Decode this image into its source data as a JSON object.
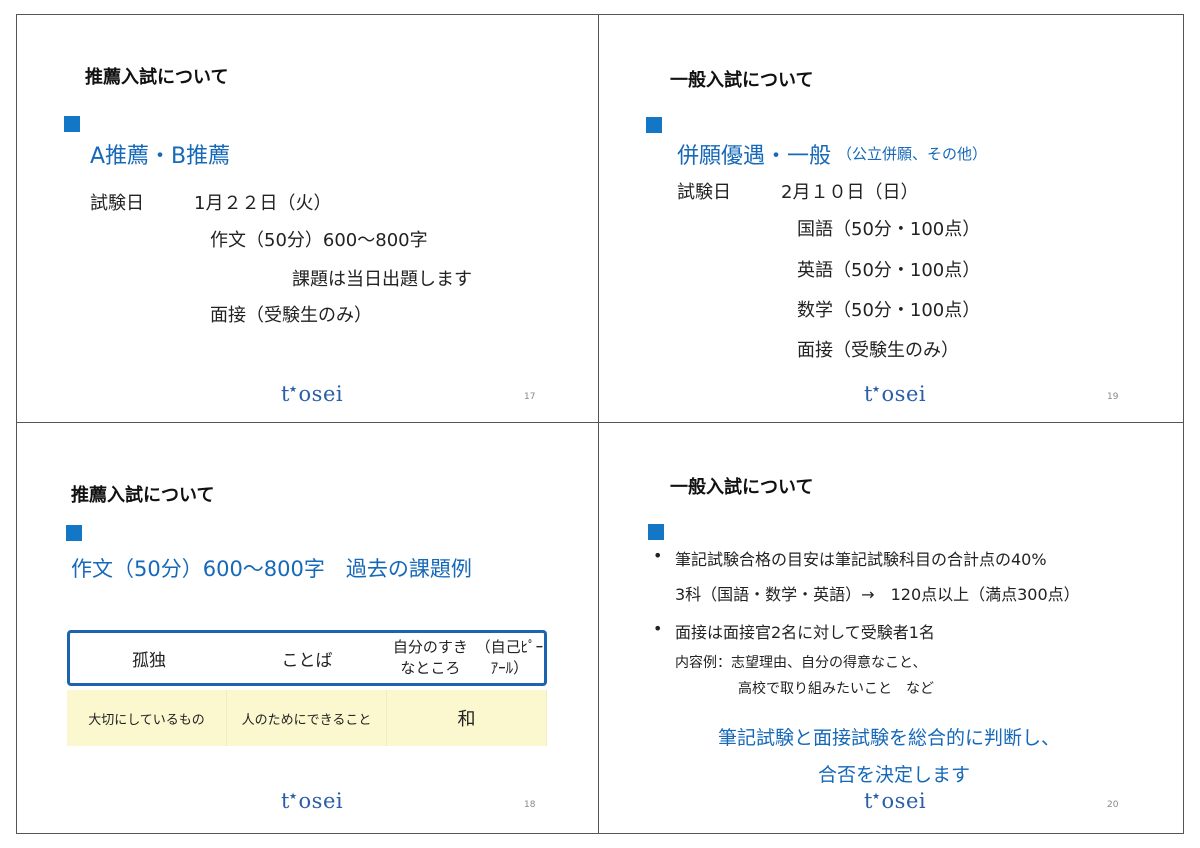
{
  "slide17": {
    "title": "推薦入試について",
    "heading": "A推薦・B推薦",
    "exam_label": "試験日",
    "exam_date": "1月２２日（火）",
    "essay": "作文（50分）600～800字",
    "essay_note": "課題は当日出題します",
    "interview": "面接（受験生のみ）",
    "logo": "tosei",
    "page": "17"
  },
  "slide19": {
    "title": "一般入試について",
    "heading": "併願優遇・一般",
    "heading_sub": "（公立併願、その他）",
    "exam_label": "試験日",
    "exam_date": "2月１０日（日）",
    "subjects": [
      "国語（50分・100点）",
      "英語（50分・100点）",
      "数学（50分・100点）"
    ],
    "interview": "面接（受験生のみ）",
    "logo": "tosei",
    "page": "19"
  },
  "slide18": {
    "title": "推薦入試について",
    "heading": "作文（50分）600～800字　過去の課題例",
    "table_head": [
      "孤独",
      "ことば",
      "自分のすきなところ",
      "（自己ﾋﾟｰｱｰﾙ）"
    ],
    "table_row": [
      "大切にしているもの",
      "人のためにできること",
      "和"
    ],
    "logo": "tosei",
    "page": "18"
  },
  "slide20": {
    "title": "一般入試について",
    "bullet1": "筆記試験合格の目安は筆記試験科目の合計点の40%",
    "bullet1_sub": "3科（国語・数学・英語）→　120点以上（満点300点）",
    "bullet2": "面接は面接官2名に対して受験者1名",
    "content_label": "内容例：志望理由、自分の得意なこと、",
    "content_line2": "高校で取り組みたいこと　など",
    "conclusion1": "筆記試験と面接試験を総合的に判断し、",
    "conclusion2": "合否を決定します",
    "logo": "tosei",
    "page": "20"
  },
  "colors": {
    "accent_blue": "#1477c5",
    "table_border": "#1d64b0",
    "table_fill": "#fbf7cf"
  }
}
